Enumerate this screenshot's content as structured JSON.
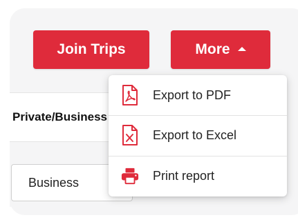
{
  "toolbar": {
    "join_trips_label": "Join Trips",
    "more_label": "More"
  },
  "table": {
    "column_header": "Private/Business",
    "type_select_value": "Business"
  },
  "more_menu": {
    "items": [
      {
        "label": "Export to PDF",
        "icon": "file-pdf-icon"
      },
      {
        "label": "Export to Excel",
        "icon": "file-excel-icon"
      },
      {
        "label": "Print report",
        "icon": "printer-icon"
      }
    ]
  },
  "colors": {
    "accent": "#df2b3b",
    "text": "#222222",
    "background": "#f5f5f6"
  }
}
